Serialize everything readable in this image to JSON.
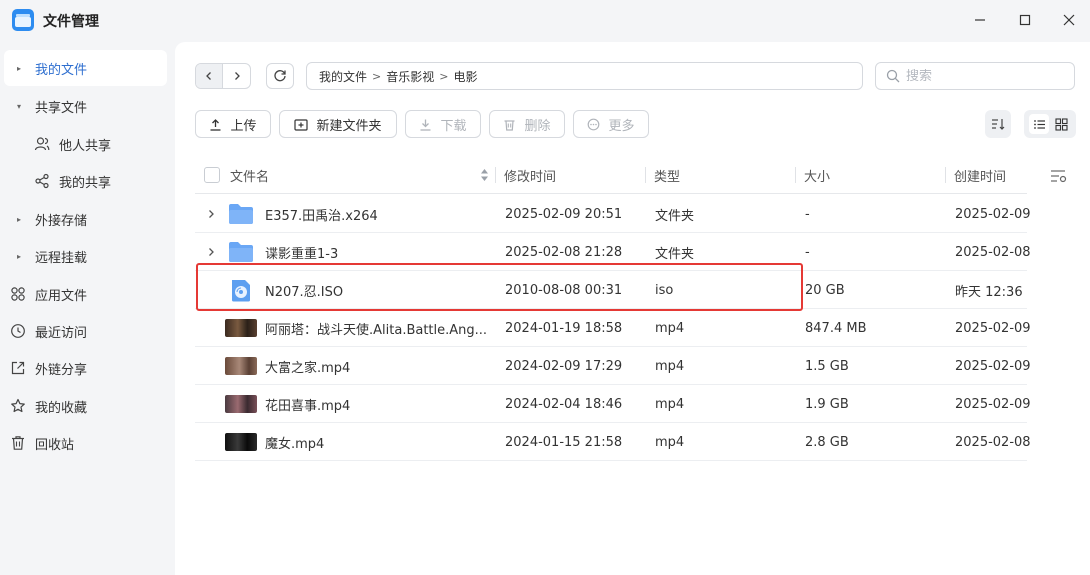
{
  "window": {
    "title": "文件管理"
  },
  "sidebar": {
    "items": [
      {
        "label": "我的文件"
      },
      {
        "label": "共享文件"
      },
      {
        "label": "他人共享"
      },
      {
        "label": "我的共享"
      },
      {
        "label": "外接存储"
      },
      {
        "label": "远程挂载"
      },
      {
        "label": "应用文件"
      },
      {
        "label": "最近访问"
      },
      {
        "label": "外链分享"
      },
      {
        "label": "我的收藏"
      },
      {
        "label": "回收站"
      }
    ]
  },
  "breadcrumb": [
    "我的文件",
    "音乐影视",
    "电影"
  ],
  "search": {
    "placeholder": "搜索"
  },
  "toolbar": {
    "upload": "上传",
    "new_folder": "新建文件夹",
    "download": "下载",
    "delete": "删除",
    "more": "更多"
  },
  "table": {
    "headers": {
      "name": "文件名",
      "modified": "修改时间",
      "type": "类型",
      "size": "大小",
      "created": "创建时间"
    },
    "rows": [
      {
        "name": "E357.田禹治.x264",
        "modified": "2025-02-09 20:51",
        "type": "文件夹",
        "size": "-",
        "created": "2025-02-09",
        "kind": "folder"
      },
      {
        "name": "谍影重重1-3",
        "modified": "2025-02-08 21:28",
        "type": "文件夹",
        "size": "-",
        "created": "2025-02-08",
        "kind": "folder"
      },
      {
        "name": "N207.忍.ISO",
        "modified": "2010-08-08 00:31",
        "type": "iso",
        "size": "20 GB",
        "created": "昨天 12:36",
        "kind": "iso"
      },
      {
        "name": "阿丽塔：战斗天使.Alita.Battle.Ang...",
        "modified": "2024-01-19 18:58",
        "type": "mp4",
        "size": "847.4 MB",
        "created": "2025-02-09",
        "kind": "video"
      },
      {
        "name": "大富之家.mp4",
        "modified": "2024-02-09 17:29",
        "type": "mp4",
        "size": "1.5 GB",
        "created": "2025-02-09",
        "kind": "video"
      },
      {
        "name": "花田喜事.mp4",
        "modified": "2024-02-04 18:46",
        "type": "mp4",
        "size": "1.9 GB",
        "created": "2025-02-09",
        "kind": "video"
      },
      {
        "name": "魔女.mp4",
        "modified": "2024-01-15 21:58",
        "type": "mp4",
        "size": "2.8 GB",
        "created": "2025-02-08",
        "kind": "video"
      }
    ]
  },
  "colors": {
    "accent": "#2d6ecf",
    "folder": "#6aa7f5",
    "highlight": "#e53935"
  }
}
